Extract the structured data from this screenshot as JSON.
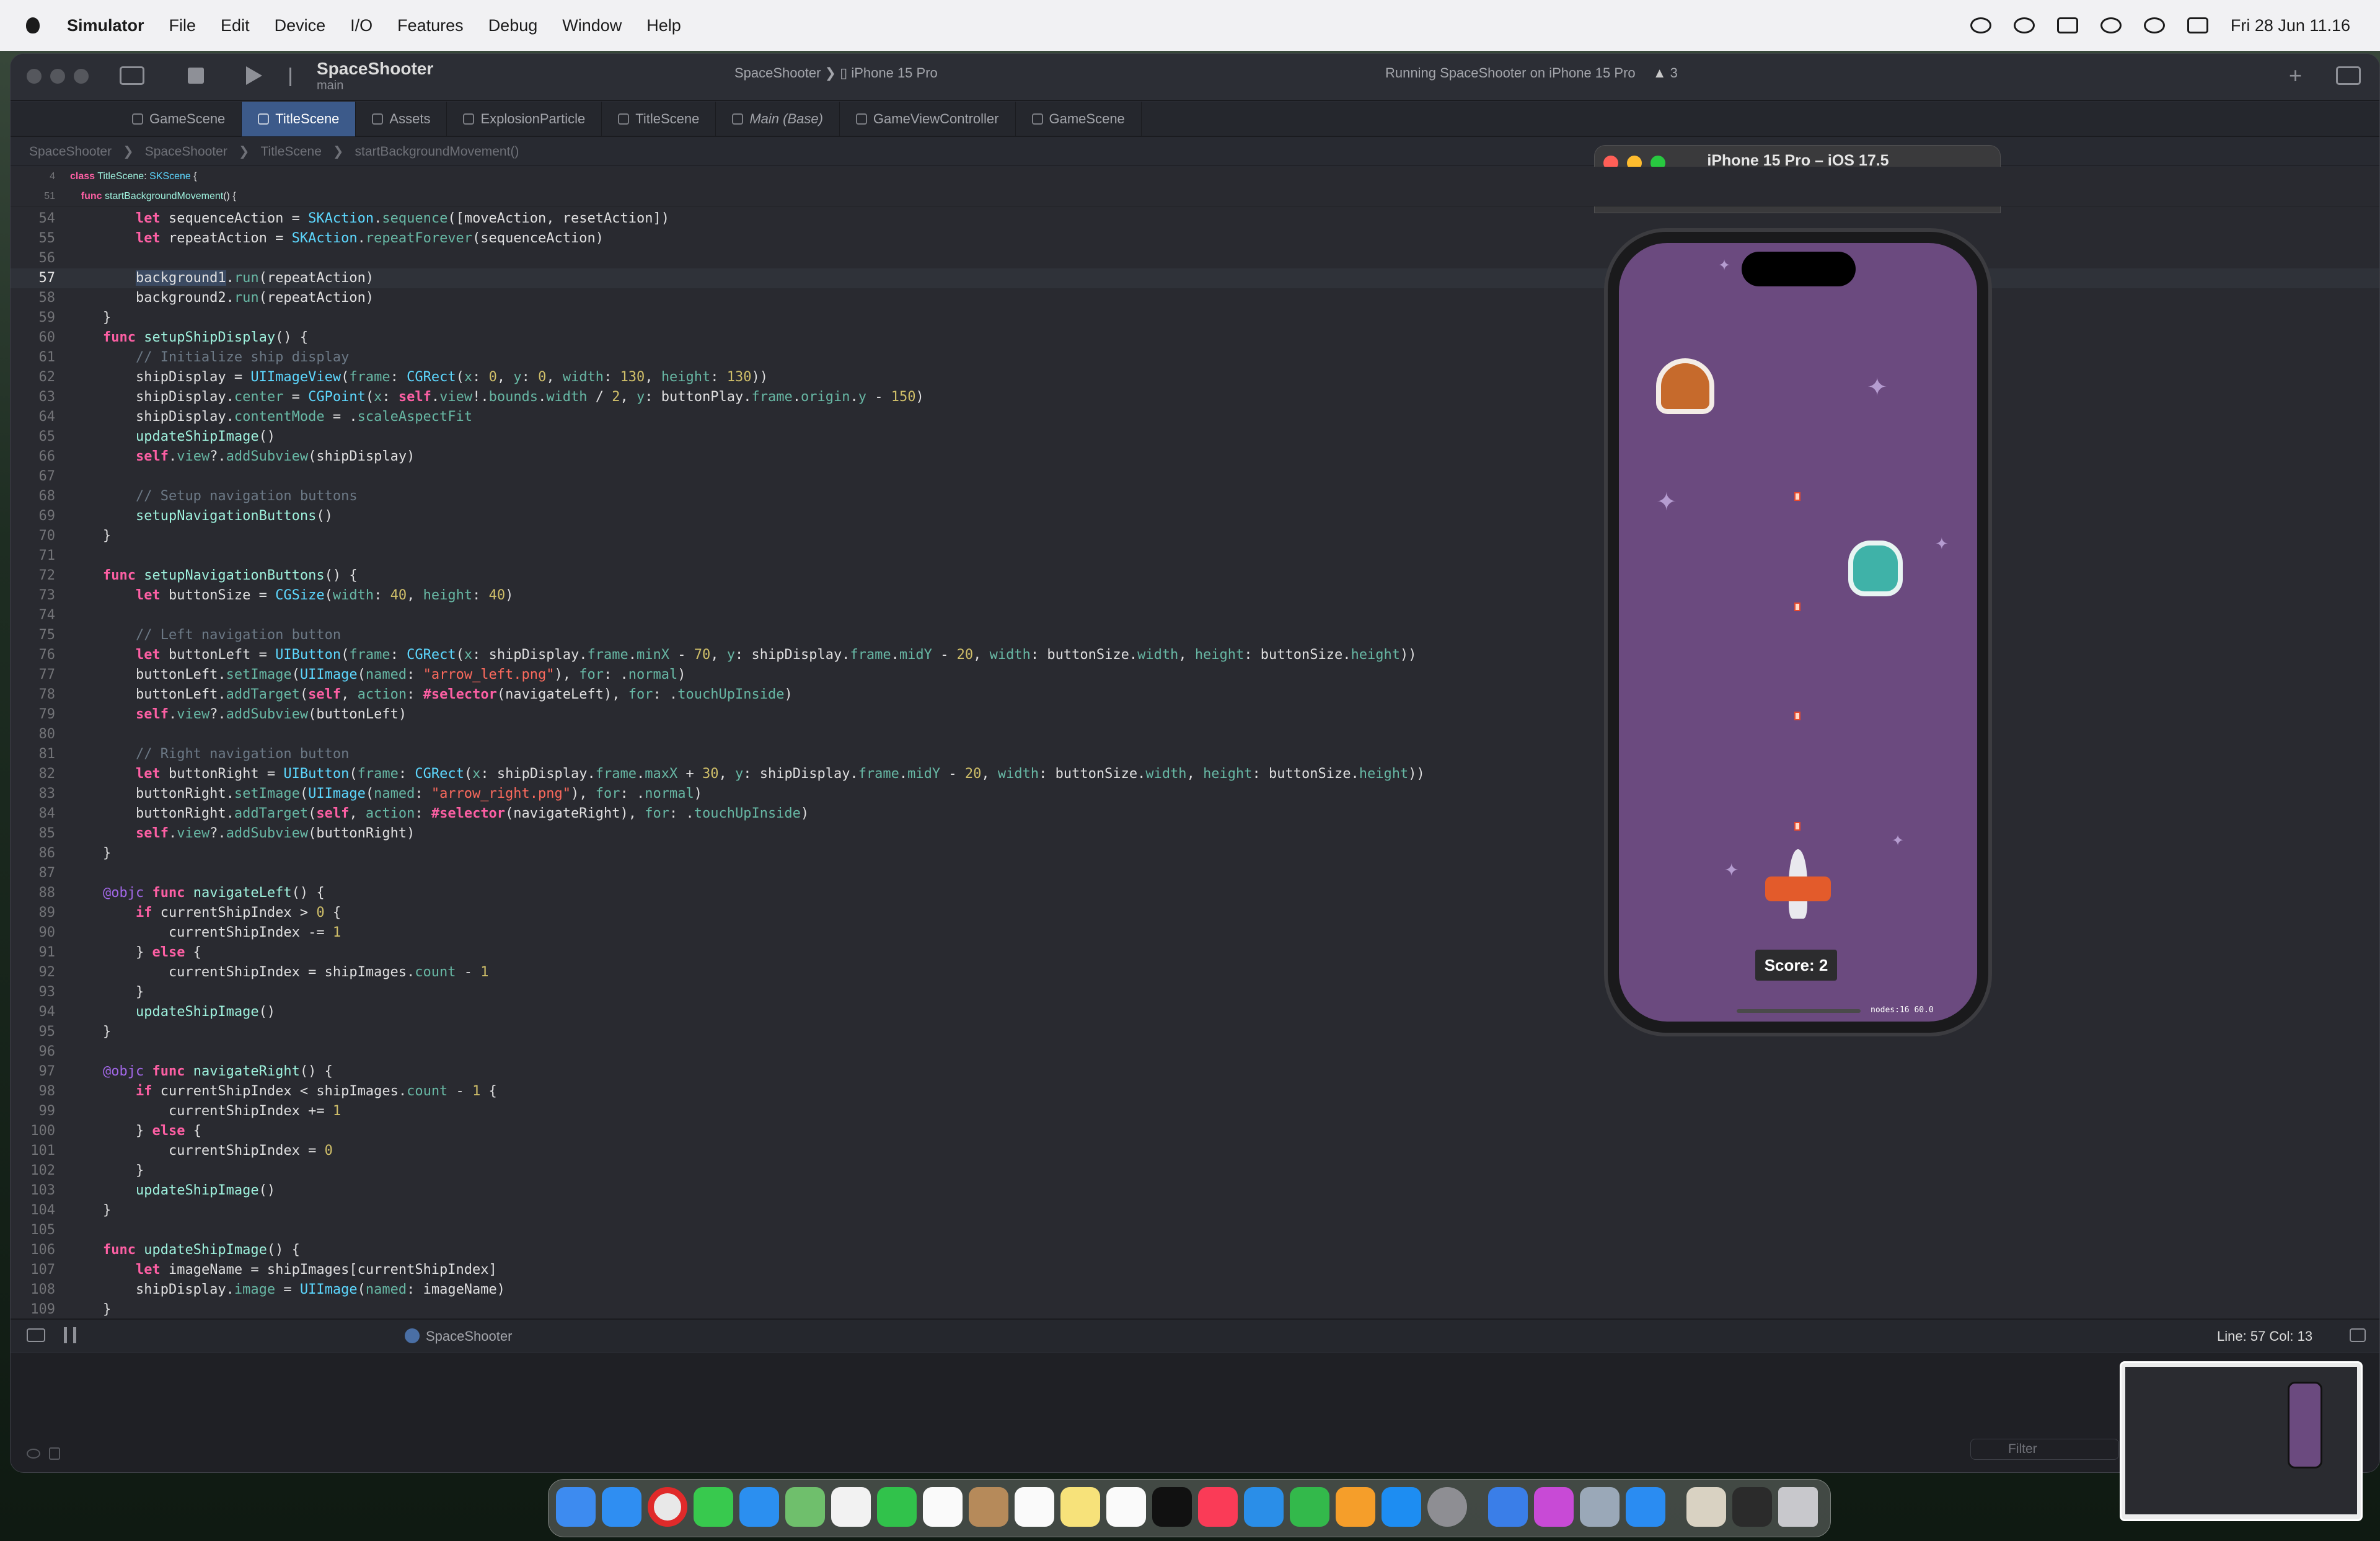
{
  "menubar": {
    "app": "Simulator",
    "items": [
      "File",
      "Edit",
      "Device",
      "I/O",
      "Features",
      "Debug",
      "Window",
      "Help"
    ],
    "datetime": "Fri 28 Jun  11.16"
  },
  "toolbar": {
    "project": "SpaceShooter",
    "branch": "main",
    "scheme": "SpaceShooter",
    "device": "iPhone 15 Pro",
    "status": "Running SpaceShooter on iPhone 15 Pro",
    "warnings": "3"
  },
  "tabs": [
    "GameScene",
    "TitleScene",
    "Assets",
    "ExplosionParticle",
    "TitleScene",
    "Main (Base)",
    "GameViewController",
    "GameScene"
  ],
  "breadcrumb": [
    "SpaceShooter",
    "SpaceShooter",
    "TitleScene",
    "startBackgroundMovement()"
  ],
  "sticky": [
    {
      "n": "4",
      "html": "<span class='kw'>class</span> <span class='tyd'>TitleScene</span>: <span class='ty'>SKScene</span> {"
    },
    {
      "n": "51",
      "html": "    <span class='kw'>func</span> <span class='tyd'>startBackgroundMovement</span>() {"
    }
  ],
  "code": [
    {
      "n": "54",
      "html": "        <span class='kw'>let</span> sequenceAction = <span class='ty'>SKAction</span>.<span class='fn'>sequence</span>([moveAction, resetAction])"
    },
    {
      "n": "55",
      "html": "        <span class='kw'>let</span> repeatAction = <span class='ty'>SKAction</span>.<span class='fn'>repeatForever</span>(sequenceAction)"
    },
    {
      "n": "56",
      "html": ""
    },
    {
      "n": "57",
      "html": "        <span class='sel'>background1</span>.<span class='fn'>run</span>(repeatAction)",
      "cur": true
    },
    {
      "n": "58",
      "html": "        background2.<span class='fn'>run</span>(repeatAction)"
    },
    {
      "n": "59",
      "html": "    }"
    },
    {
      "n": "60",
      "html": "    <span class='kw'>func</span> <span class='tyd'>setupShipDisplay</span>() {"
    },
    {
      "n": "61",
      "html": "        <span class='cm'>// Initialize ship display</span>"
    },
    {
      "n": "62",
      "html": "        shipDisplay = <span class='ty'>UIImageView</span>(<span class='fn'>frame</span>: <span class='ty'>CGRect</span>(<span class='fn'>x</span>: <span class='nu'>0</span>, <span class='fn'>y</span>: <span class='nu'>0</span>, <span class='fn'>width</span>: <span class='nu'>130</span>, <span class='fn'>height</span>: <span class='nu'>130</span>))"
    },
    {
      "n": "63",
      "html": "        shipDisplay.<span class='fn'>center</span> = <span class='ty'>CGPoint</span>(<span class='fn'>x</span>: <span class='kw'>self</span>.<span class='fn'>view</span>!.<span class='fn'>bounds</span>.<span class='fn'>width</span> / <span class='nu'>2</span>, <span class='fn'>y</span>: buttonPlay.<span class='fn'>frame</span>.<span class='fn'>origin</span>.<span class='fn'>y</span> - <span class='nu'>150</span>)"
    },
    {
      "n": "64",
      "html": "        shipDisplay.<span class='fn'>contentMode</span> = .<span class='fn'>scaleAspectFit</span>"
    },
    {
      "n": "65",
      "html": "        <span class='tyd'>updateShipImage</span>()"
    },
    {
      "n": "66",
      "html": "        <span class='kw'>self</span>.<span class='fn'>view</span>?.<span class='fn'>addSubview</span>(shipDisplay)"
    },
    {
      "n": "67",
      "html": ""
    },
    {
      "n": "68",
      "html": "        <span class='cm'>// Setup navigation buttons</span>"
    },
    {
      "n": "69",
      "html": "        <span class='tyd'>setupNavigationButtons</span>()"
    },
    {
      "n": "70",
      "html": "    }"
    },
    {
      "n": "71",
      "html": ""
    },
    {
      "n": "72",
      "html": "    <span class='kw'>func</span> <span class='tyd'>setupNavigationButtons</span>() {"
    },
    {
      "n": "73",
      "html": "        <span class='kw'>let</span> buttonSize = <span class='ty'>CGSize</span>(<span class='fn'>width</span>: <span class='nu'>40</span>, <span class='fn'>height</span>: <span class='nu'>40</span>)"
    },
    {
      "n": "74",
      "html": ""
    },
    {
      "n": "75",
      "html": "        <span class='cm'>// Left navigation button</span>"
    },
    {
      "n": "76",
      "html": "        <span class='kw'>let</span> buttonLeft = <span class='ty'>UIButton</span>(<span class='fn'>frame</span>: <span class='ty'>CGRect</span>(<span class='fn'>x</span>: shipDisplay.<span class='fn'>frame</span>.<span class='fn'>minX</span> - <span class='nu'>70</span>, <span class='fn'>y</span>: shipDisplay.<span class='fn'>frame</span>.<span class='fn'>midY</span> - <span class='nu'>20</span>, <span class='fn'>width</span>: buttonSize.<span class='fn'>width</span>, <span class='fn'>height</span>: buttonSize.<span class='fn'>height</span>))"
    },
    {
      "n": "77",
      "html": "        buttonLeft.<span class='fn'>setImage</span>(<span class='ty'>UIImage</span>(<span class='fn'>named</span>: <span class='st'>\"arrow_left.png\"</span>), <span class='fn'>for</span>: .<span class='fn'>normal</span>)"
    },
    {
      "n": "78",
      "html": "        buttonLeft.<span class='fn'>addTarget</span>(<span class='kw'>self</span>, <span class='fn'>action</span>: <span class='kw'>#selector</span>(navigateLeft), <span class='fn'>for</span>: .<span class='fn'>touchUpInside</span>)"
    },
    {
      "n": "79",
      "html": "        <span class='kw'>self</span>.<span class='fn'>view</span>?.<span class='fn'>addSubview</span>(buttonLeft)"
    },
    {
      "n": "80",
      "html": ""
    },
    {
      "n": "81",
      "html": "        <span class='cm'>// Right navigation button</span>"
    },
    {
      "n": "82",
      "html": "        <span class='kw'>let</span> buttonRight = <span class='ty'>UIButton</span>(<span class='fn'>frame</span>: <span class='ty'>CGRect</span>(<span class='fn'>x</span>: shipDisplay.<span class='fn'>frame</span>.<span class='fn'>maxX</span> + <span class='nu'>30</span>, <span class='fn'>y</span>: shipDisplay.<span class='fn'>frame</span>.<span class='fn'>midY</span> - <span class='nu'>20</span>, <span class='fn'>width</span>: buttonSize.<span class='fn'>width</span>, <span class='fn'>height</span>: buttonSize.<span class='fn'>height</span>))"
    },
    {
      "n": "83",
      "html": "        buttonRight.<span class='fn'>setImage</span>(<span class='ty'>UIImage</span>(<span class='fn'>named</span>: <span class='st'>\"arrow_right.png\"</span>), <span class='fn'>for</span>: .<span class='fn'>normal</span>)"
    },
    {
      "n": "84",
      "html": "        buttonRight.<span class='fn'>addTarget</span>(<span class='kw'>self</span>, <span class='fn'>action</span>: <span class='kw'>#selector</span>(navigateRight), <span class='fn'>for</span>: .<span class='fn'>touchUpInside</span>)"
    },
    {
      "n": "85",
      "html": "        <span class='kw'>self</span>.<span class='fn'>view</span>?.<span class='fn'>addSubview</span>(buttonRight)"
    },
    {
      "n": "86",
      "html": "    }"
    },
    {
      "n": "87",
      "html": ""
    },
    {
      "n": "88",
      "html": "    <span class='pr'>@objc</span> <span class='kw'>func</span> <span class='tyd'>navigateLeft</span>() {"
    },
    {
      "n": "89",
      "html": "        <span class='kw'>if</span> currentShipIndex > <span class='nu'>0</span> {"
    },
    {
      "n": "90",
      "html": "            currentShipIndex -= <span class='nu'>1</span>"
    },
    {
      "n": "91",
      "html": "        } <span class='kw'>else</span> {"
    },
    {
      "n": "92",
      "html": "            currentShipIndex = shipImages.<span class='fn'>count</span> - <span class='nu'>1</span>"
    },
    {
      "n": "93",
      "html": "        }"
    },
    {
      "n": "94",
      "html": "        <span class='tyd'>updateShipImage</span>()"
    },
    {
      "n": "95",
      "html": "    }"
    },
    {
      "n": "96",
      "html": ""
    },
    {
      "n": "97",
      "html": "    <span class='pr'>@objc</span> <span class='kw'>func</span> <span class='tyd'>navigateRight</span>() {"
    },
    {
      "n": "98",
      "html": "        <span class='kw'>if</span> currentShipIndex < shipImages.<span class='fn'>count</span> - <span class='nu'>1</span> {"
    },
    {
      "n": "99",
      "html": "            currentShipIndex += <span class='nu'>1</span>"
    },
    {
      "n": "100",
      "html": "        } <span class='kw'>else</span> {"
    },
    {
      "n": "101",
      "html": "            currentShipIndex = <span class='nu'>0</span>"
    },
    {
      "n": "102",
      "html": "        }"
    },
    {
      "n": "103",
      "html": "        <span class='tyd'>updateShipImage</span>()"
    },
    {
      "n": "104",
      "html": "    }"
    },
    {
      "n": "105",
      "html": ""
    },
    {
      "n": "106",
      "html": "    <span class='kw'>func</span> <span class='tyd'>updateShipImage</span>() {"
    },
    {
      "n": "107",
      "html": "        <span class='kw'>let</span> imageName = shipImages[currentShipIndex]"
    },
    {
      "n": "108",
      "html": "        shipDisplay.<span class='fn'>image</span> = <span class='ty'>UIImage</span>(<span class='fn'>named</span>: imageName)"
    },
    {
      "n": "109",
      "html": "    }"
    }
  ],
  "debug": {
    "target": "SpaceShooter",
    "position": "Line: 57  Col: 13",
    "filter_placeholder": "Filter"
  },
  "simulator": {
    "title": "iPhone 15 Pro – iOS 17.5",
    "score": "Score: 2",
    "nodes": "nodes:16  60.0"
  }
}
